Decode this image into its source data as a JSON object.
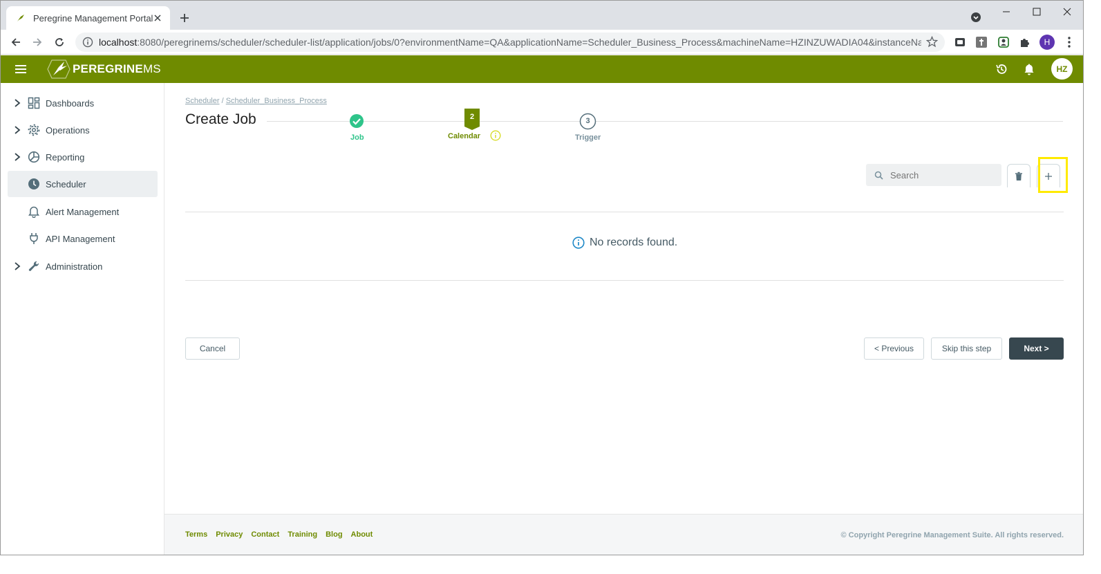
{
  "browser": {
    "tab_title": "Peregrine Management Portal",
    "url_host": "localhost",
    "url_rest": ":8080/peregrinems/scheduler/scheduler-list/application/jobs/0?environmentName=QA&applicationName=Scheduler_Business_Process&machineName=HZINZUWADIA04&instanceNa...",
    "profile_initial": "H"
  },
  "header": {
    "logo_main": "PEREGRINE",
    "logo_suffix": "MS",
    "avatar_initials": "HZ",
    "brand_color": "#6f8b00"
  },
  "sidebar": {
    "items": [
      {
        "label": "Dashboards",
        "icon": "dashboard-icon",
        "expandable": true
      },
      {
        "label": "Operations",
        "icon": "gear-icon",
        "expandable": true
      },
      {
        "label": "Reporting",
        "icon": "pie-chart-icon",
        "expandable": true
      },
      {
        "label": "Scheduler",
        "icon": "clock-icon",
        "expandable": false,
        "active": true
      },
      {
        "label": "Alert Management",
        "icon": "bell-icon",
        "expandable": false
      },
      {
        "label": "API Management",
        "icon": "plug-icon",
        "expandable": false
      },
      {
        "label": "Administration",
        "icon": "wrench-icon",
        "expandable": true
      }
    ]
  },
  "breadcrumb": {
    "root": "Scheduler",
    "separator": " / ",
    "current": "Scheduler_Business_Process"
  },
  "page": {
    "title": "Create Job"
  },
  "stepper": {
    "steps": [
      {
        "label": "Job",
        "number": "1",
        "state": "complete"
      },
      {
        "label": "Calendar",
        "number": "2",
        "state": "active"
      },
      {
        "label": "Trigger",
        "number": "3",
        "state": "pending"
      }
    ]
  },
  "table": {
    "search_placeholder": "Search",
    "empty_message": "No records found."
  },
  "actions": {
    "cancel": "Cancel",
    "previous": "< Previous",
    "skip": "Skip this step",
    "next": "Next >"
  },
  "footer": {
    "links": [
      "Terms",
      "Privacy",
      "Contact",
      "Training",
      "Blog",
      "About"
    ],
    "copyright": "© Copyright Peregrine Management Suite. All rights reserved."
  }
}
